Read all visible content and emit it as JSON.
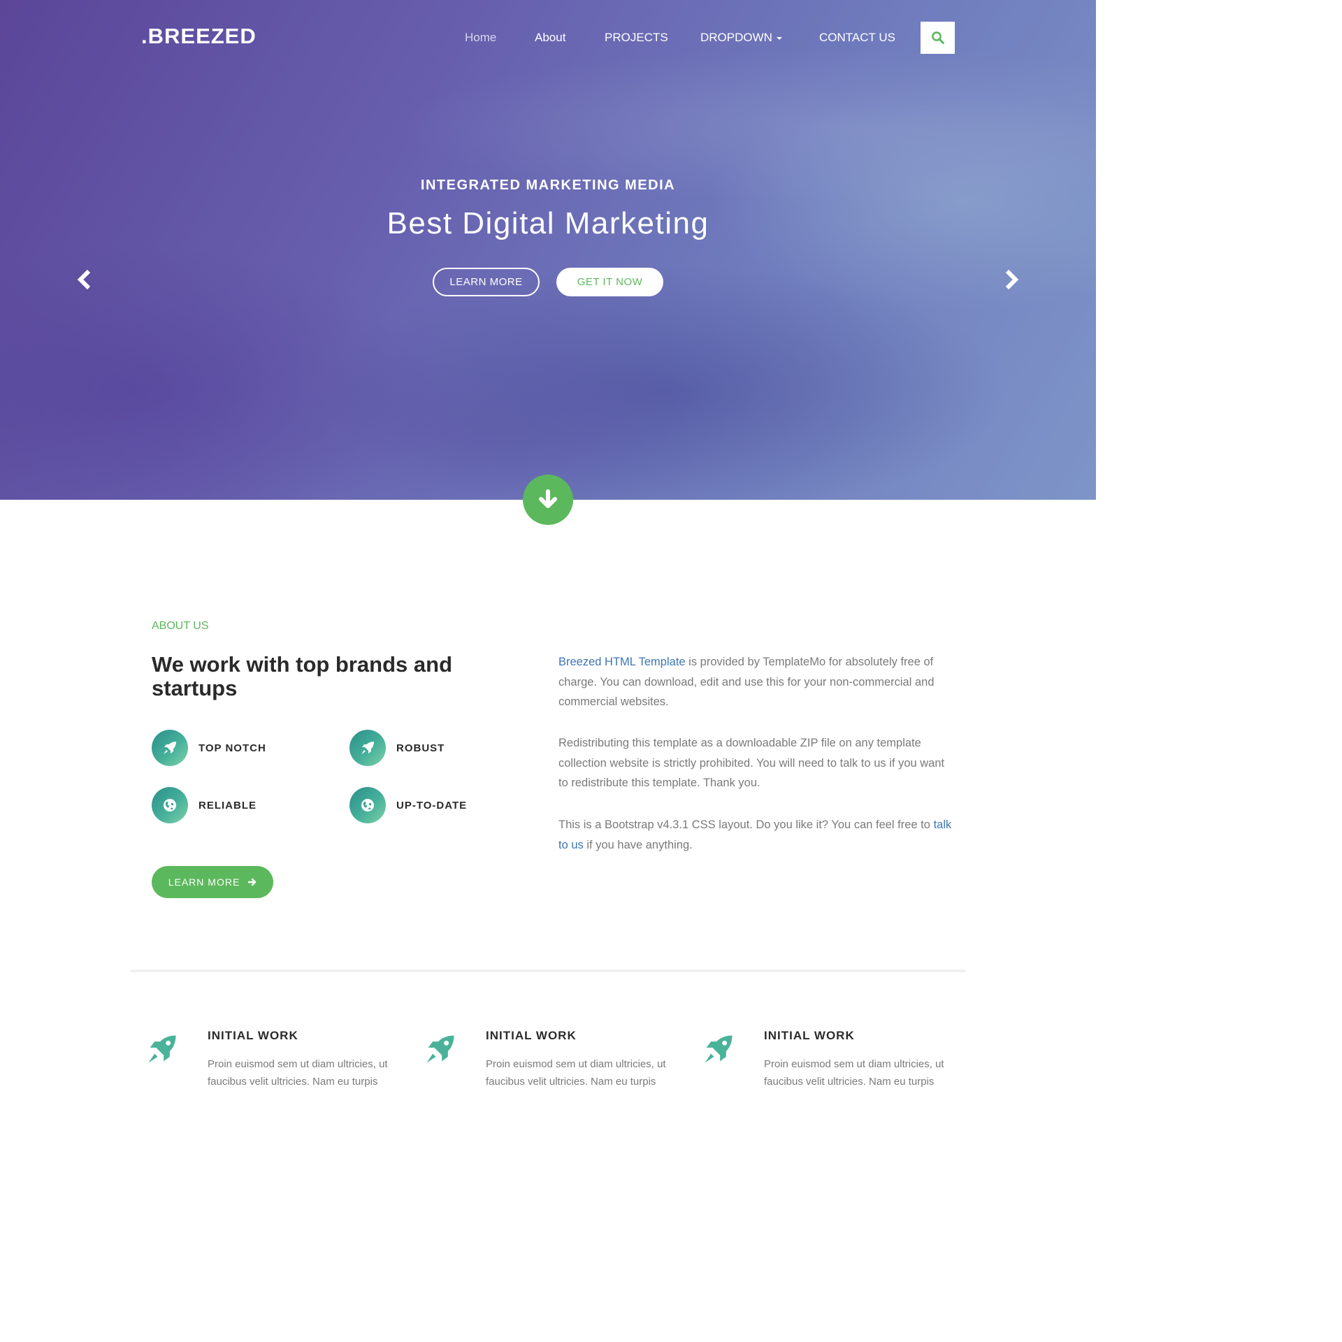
{
  "header": {
    "brand": ".BREEZED",
    "nav": [
      "Home",
      "About",
      "PROJECTS",
      "DROPDOWN",
      "CONTACT US"
    ],
    "search_icon": "search-icon"
  },
  "hero": {
    "subtitle": "INTEGRATED MARKETING MEDIA",
    "title": "Best Digital Marketing",
    "btn_learn": "LEARN MORE",
    "btn_get": "GET IT NOW",
    "prev_icon": "chevron-left-icon",
    "next_icon": "chevron-right-icon",
    "scroll_icon": "arrow-down-icon"
  },
  "about": {
    "label": "ABOUT US",
    "heading": "We work with top brands and startups",
    "features": [
      "TOP NOTCH",
      "ROBUST",
      "RELIABLE",
      "UP-TO-DATE"
    ],
    "button": "LEARN MORE",
    "p1_link": "Breezed HTML Template",
    "p1_text": " is provided by TemplateMo for absolutely free of charge. You can download, edit and use this for your non-commercial and commercial websites.",
    "p2": "Redistributing this template as a downloadable ZIP file on any template collection website is strictly prohibited. You will need to talk to us if you want to redistribute this template. Thank you.",
    "p3_pre": "This is a Bootstrap v4.3.1 CSS layout. Do you like it? You can feel free to ",
    "p3_link": "talk to us",
    "p3_post": " if you have anything."
  },
  "services": [
    {
      "title": "INITIAL WORK",
      "text": "Proin euismod sem ut diam ultricies, ut faucibus velit ultricies. Nam eu turpis"
    },
    {
      "title": "INITIAL WORK",
      "text": "Proin euismod sem ut diam ultricies, ut faucibus velit ultricies. Nam eu turpis"
    },
    {
      "title": "INITIAL WORK",
      "text": "Proin euismod sem ut diam ultricies, ut faucibus velit ultricies. Nam eu turpis"
    }
  ],
  "colors": {
    "accent_green": "#5cb85c",
    "link_blue": "#3d76b5",
    "teal": "#46b09a"
  }
}
